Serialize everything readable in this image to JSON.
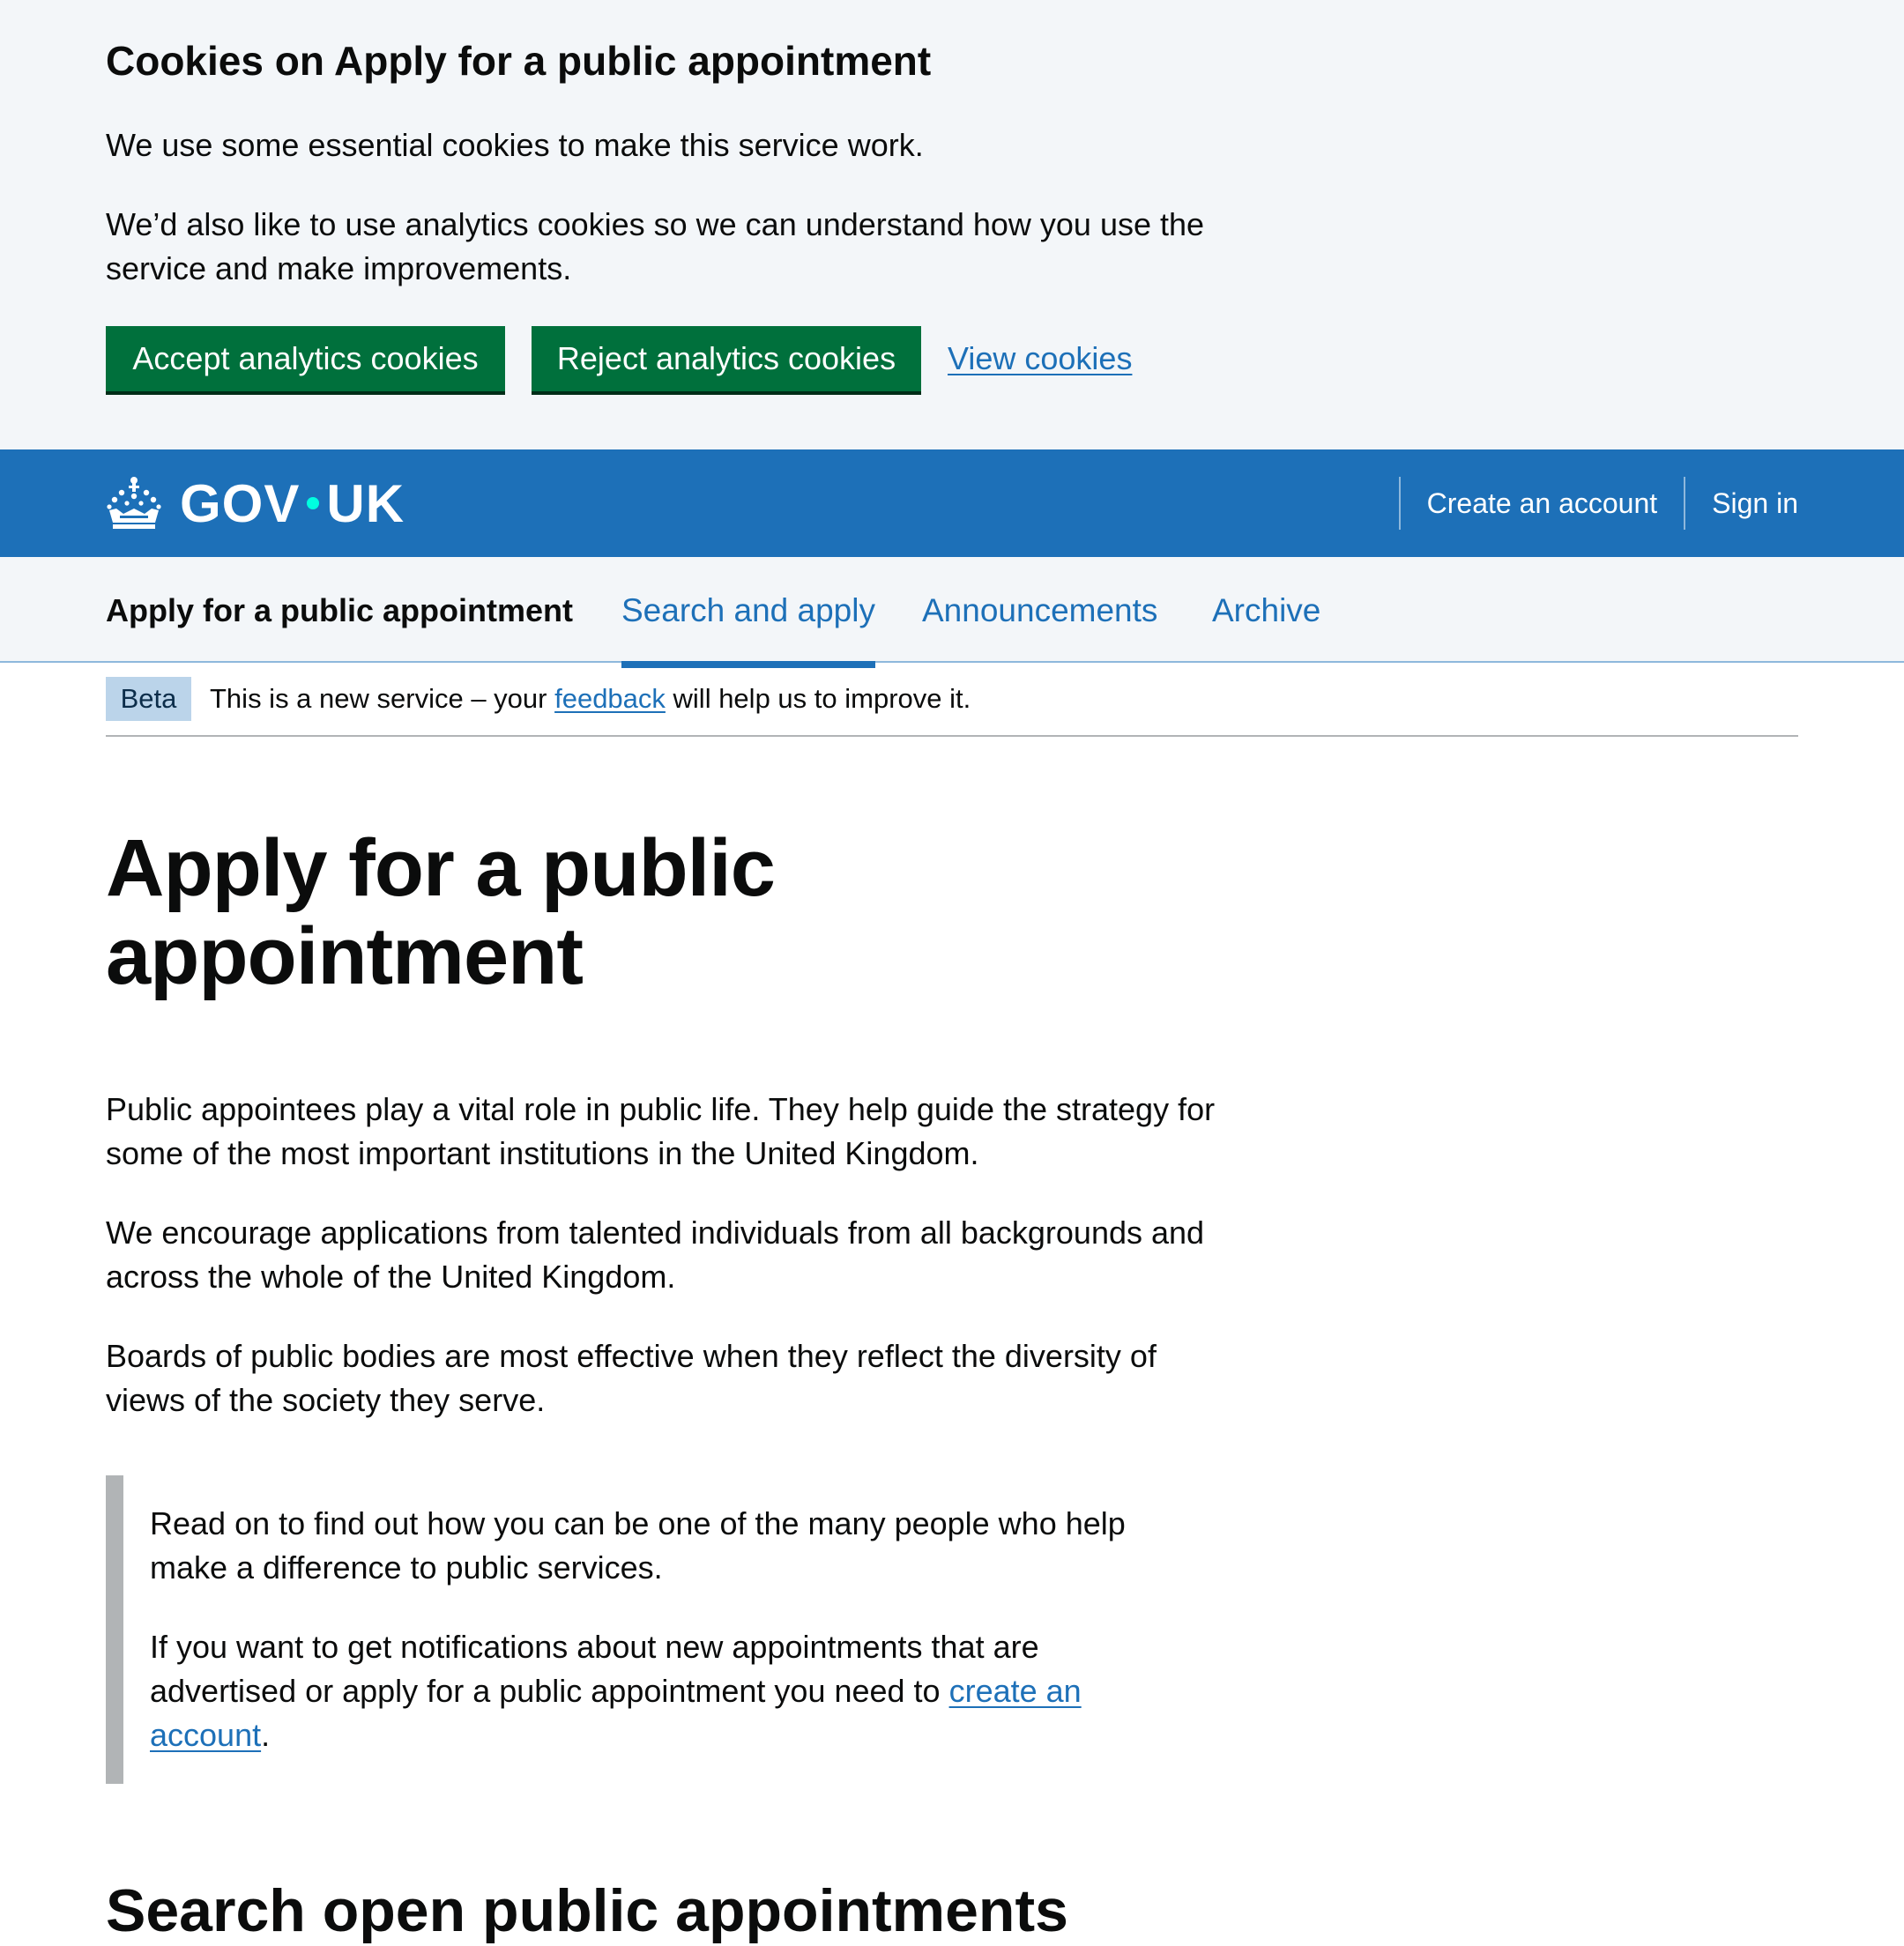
{
  "cookie_banner": {
    "title": "Cookies on Apply for a public appointment",
    "paragraph_1": "We use some essential cookies to make this service work.",
    "paragraph_2": "We’d also like to use analytics cookies so we can understand how you use the service and make improvements.",
    "accept_label": "Accept analytics cookies",
    "reject_label": "Reject analytics cookies",
    "view_label": "View cookies"
  },
  "header": {
    "logo_left": "GOV",
    "logo_right": "UK",
    "logo_icon": "crown-icon",
    "links": [
      "Create an account",
      "Sign in"
    ]
  },
  "service_nav": {
    "service_name": "Apply for a public appointment",
    "items": [
      "Search and apply",
      "Announcements",
      "Archive"
    ],
    "active_item": "Search and apply"
  },
  "phase_banner": {
    "tag": "Beta",
    "text_before": "This is a new service – your ",
    "link": "feedback",
    "text_after": " will help us to improve it."
  },
  "main": {
    "title": "Apply for a public appointment",
    "paragraphs": [
      "Public appointees play a vital role in public life. They help guide the strategy for some of the most important institutions in the United Kingdom.",
      "We encourage applications from talented individuals from all backgrounds and across the whole of the United Kingdom.",
      "Boards of public bodies are most effective when they reflect the diversity of views of the society they serve."
    ],
    "inset": {
      "paragraph_1": "Read on to find out how you can be one of the many people who help make a difference to public services.",
      "paragraph_2_before": "If you want to get notifications about new appointments that are advertised or apply for a public appointment you need to ",
      "paragraph_2_link": "create an account",
      "paragraph_2_after": "."
    },
    "next_heading": "Search open public appointments"
  },
  "colors": {
    "brand_blue": "#1d70b8",
    "button_green": "#00703c",
    "banner_bg": "#f3f6f9",
    "link": "#1d70b8",
    "text": "#0b0c0c",
    "beta_tag_bg": "#bbd4ea",
    "inset_border": "#b1b4b6"
  }
}
